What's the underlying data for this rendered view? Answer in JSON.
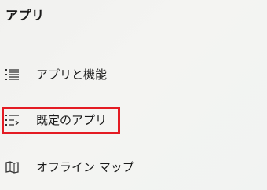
{
  "section": {
    "title": "アプリ"
  },
  "nav_items": [
    {
      "label": "アプリと機能",
      "icon": "apps-features-list-icon"
    },
    {
      "label": "既定のアプリ",
      "icon": "default-apps-list-icon"
    },
    {
      "label": "オフライン マップ",
      "icon": "offline-map-icon"
    }
  ],
  "highlight": {
    "color": "#e41b23",
    "target": "既定のアプリ"
  }
}
